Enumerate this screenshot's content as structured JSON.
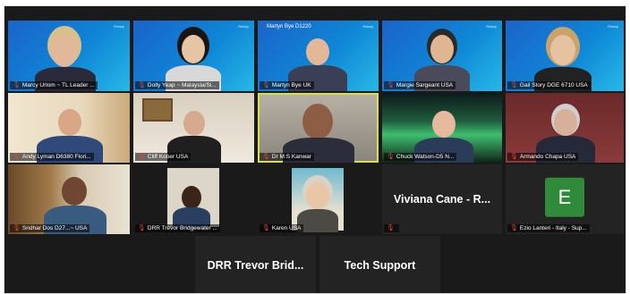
{
  "participants": [
    {
      "name": "Marcy Urlom ~ TL Leader ...",
      "muted": true
    },
    {
      "name": "Dolly Yeap ~ Malaysia/Si...",
      "muted": true
    },
    {
      "name": "Martyn Bye UK",
      "muted": true,
      "banner": "Martyn Bye D1220"
    },
    {
      "name": "Margie Sargeant USA",
      "muted": true
    },
    {
      "name": "Gail Story DGE 6710 USA",
      "muted": true
    },
    {
      "name": "Andy Lyman D6380 Flori...",
      "muted": true
    },
    {
      "name": "Cliff Kober USA",
      "muted": true
    },
    {
      "name": "Dr M S Kanwar",
      "muted": true,
      "active": true
    },
    {
      "name": "Chuck Watson-D5 N...",
      "muted": true
    },
    {
      "name": "Armando Chapa USA",
      "muted": true
    },
    {
      "name": "Sridhar Dos D27...~ USA",
      "muted": true
    },
    {
      "name": "DRR Trevor Bridgewater ...",
      "muted": true
    },
    {
      "name": "Karen USA",
      "muted": true
    },
    {
      "name": "",
      "muted": true,
      "display_text": "Viviana Cane - R..."
    },
    {
      "name": "Ezio Lanteri - Italy - Sup...",
      "muted": true,
      "avatar_letter": "E",
      "avatar_color": "#2f8a3a"
    }
  ],
  "bottom_tiles": [
    {
      "display_text": "DRR Trevor Brid..."
    },
    {
      "display_text": "Tech Support"
    }
  ],
  "logo_text": "Rotary",
  "colors": {
    "active_border": "#d7e04a",
    "muted_icon": "#e2453a",
    "background": "#1a1a1a"
  }
}
